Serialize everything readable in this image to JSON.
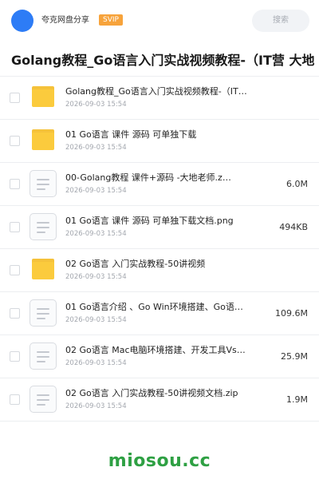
{
  "header": {
    "owner": "夸克网盘分享",
    "badge": "SVIP",
    "search_label": "搜索"
  },
  "page_title": "Golang教程_Go语言入门实战视频教程-（IT营 大地老师）",
  "files": [
    {
      "type": "folder",
      "name": "Golang教程_Go语言入门实战视频教程-（IT…",
      "date": "2026-09-03 15:54",
      "size": ""
    },
    {
      "type": "folder",
      "name": "01 Go语言 课件 源码 可单独下载",
      "date": "2026-09-03 15:54",
      "size": ""
    },
    {
      "type": "file",
      "name": "00-Golang教程 课件+源码 -大地老师.z…",
      "date": "2026-09-03 15:54",
      "size": "6.0M"
    },
    {
      "type": "file",
      "name": "01 Go语言 课件 源码 可单独下载文档.png",
      "date": "2026-09-03 15:54",
      "size": "494KB"
    },
    {
      "type": "folder",
      "name": "02 Go语言 入门实战教程-50讲视频",
      "date": "2026-09-03 15:54",
      "size": ""
    },
    {
      "type": "file",
      "name": "01 Go语言介绍 、Go Win环境搭建、Go语…",
      "date": "2026-09-03 15:54",
      "size": "109.6M"
    },
    {
      "type": "file",
      "name": "02  Go语言 Mac电脑环境搭建、开发工具Vs…",
      "date": "2026-09-03 15:54",
      "size": "25.9M"
    },
    {
      "type": "file",
      "name": "02 Go语言 入门实战教程-50讲视频文档.zip",
      "date": "2026-09-03 15:54",
      "size": "1.9M"
    }
  ],
  "watermark": "miosou.cc",
  "colors": {
    "avatar": "#2d7cf6",
    "badge": "#f7a33b",
    "folder": "#fbcb3d",
    "watermark": "#2ea043"
  }
}
